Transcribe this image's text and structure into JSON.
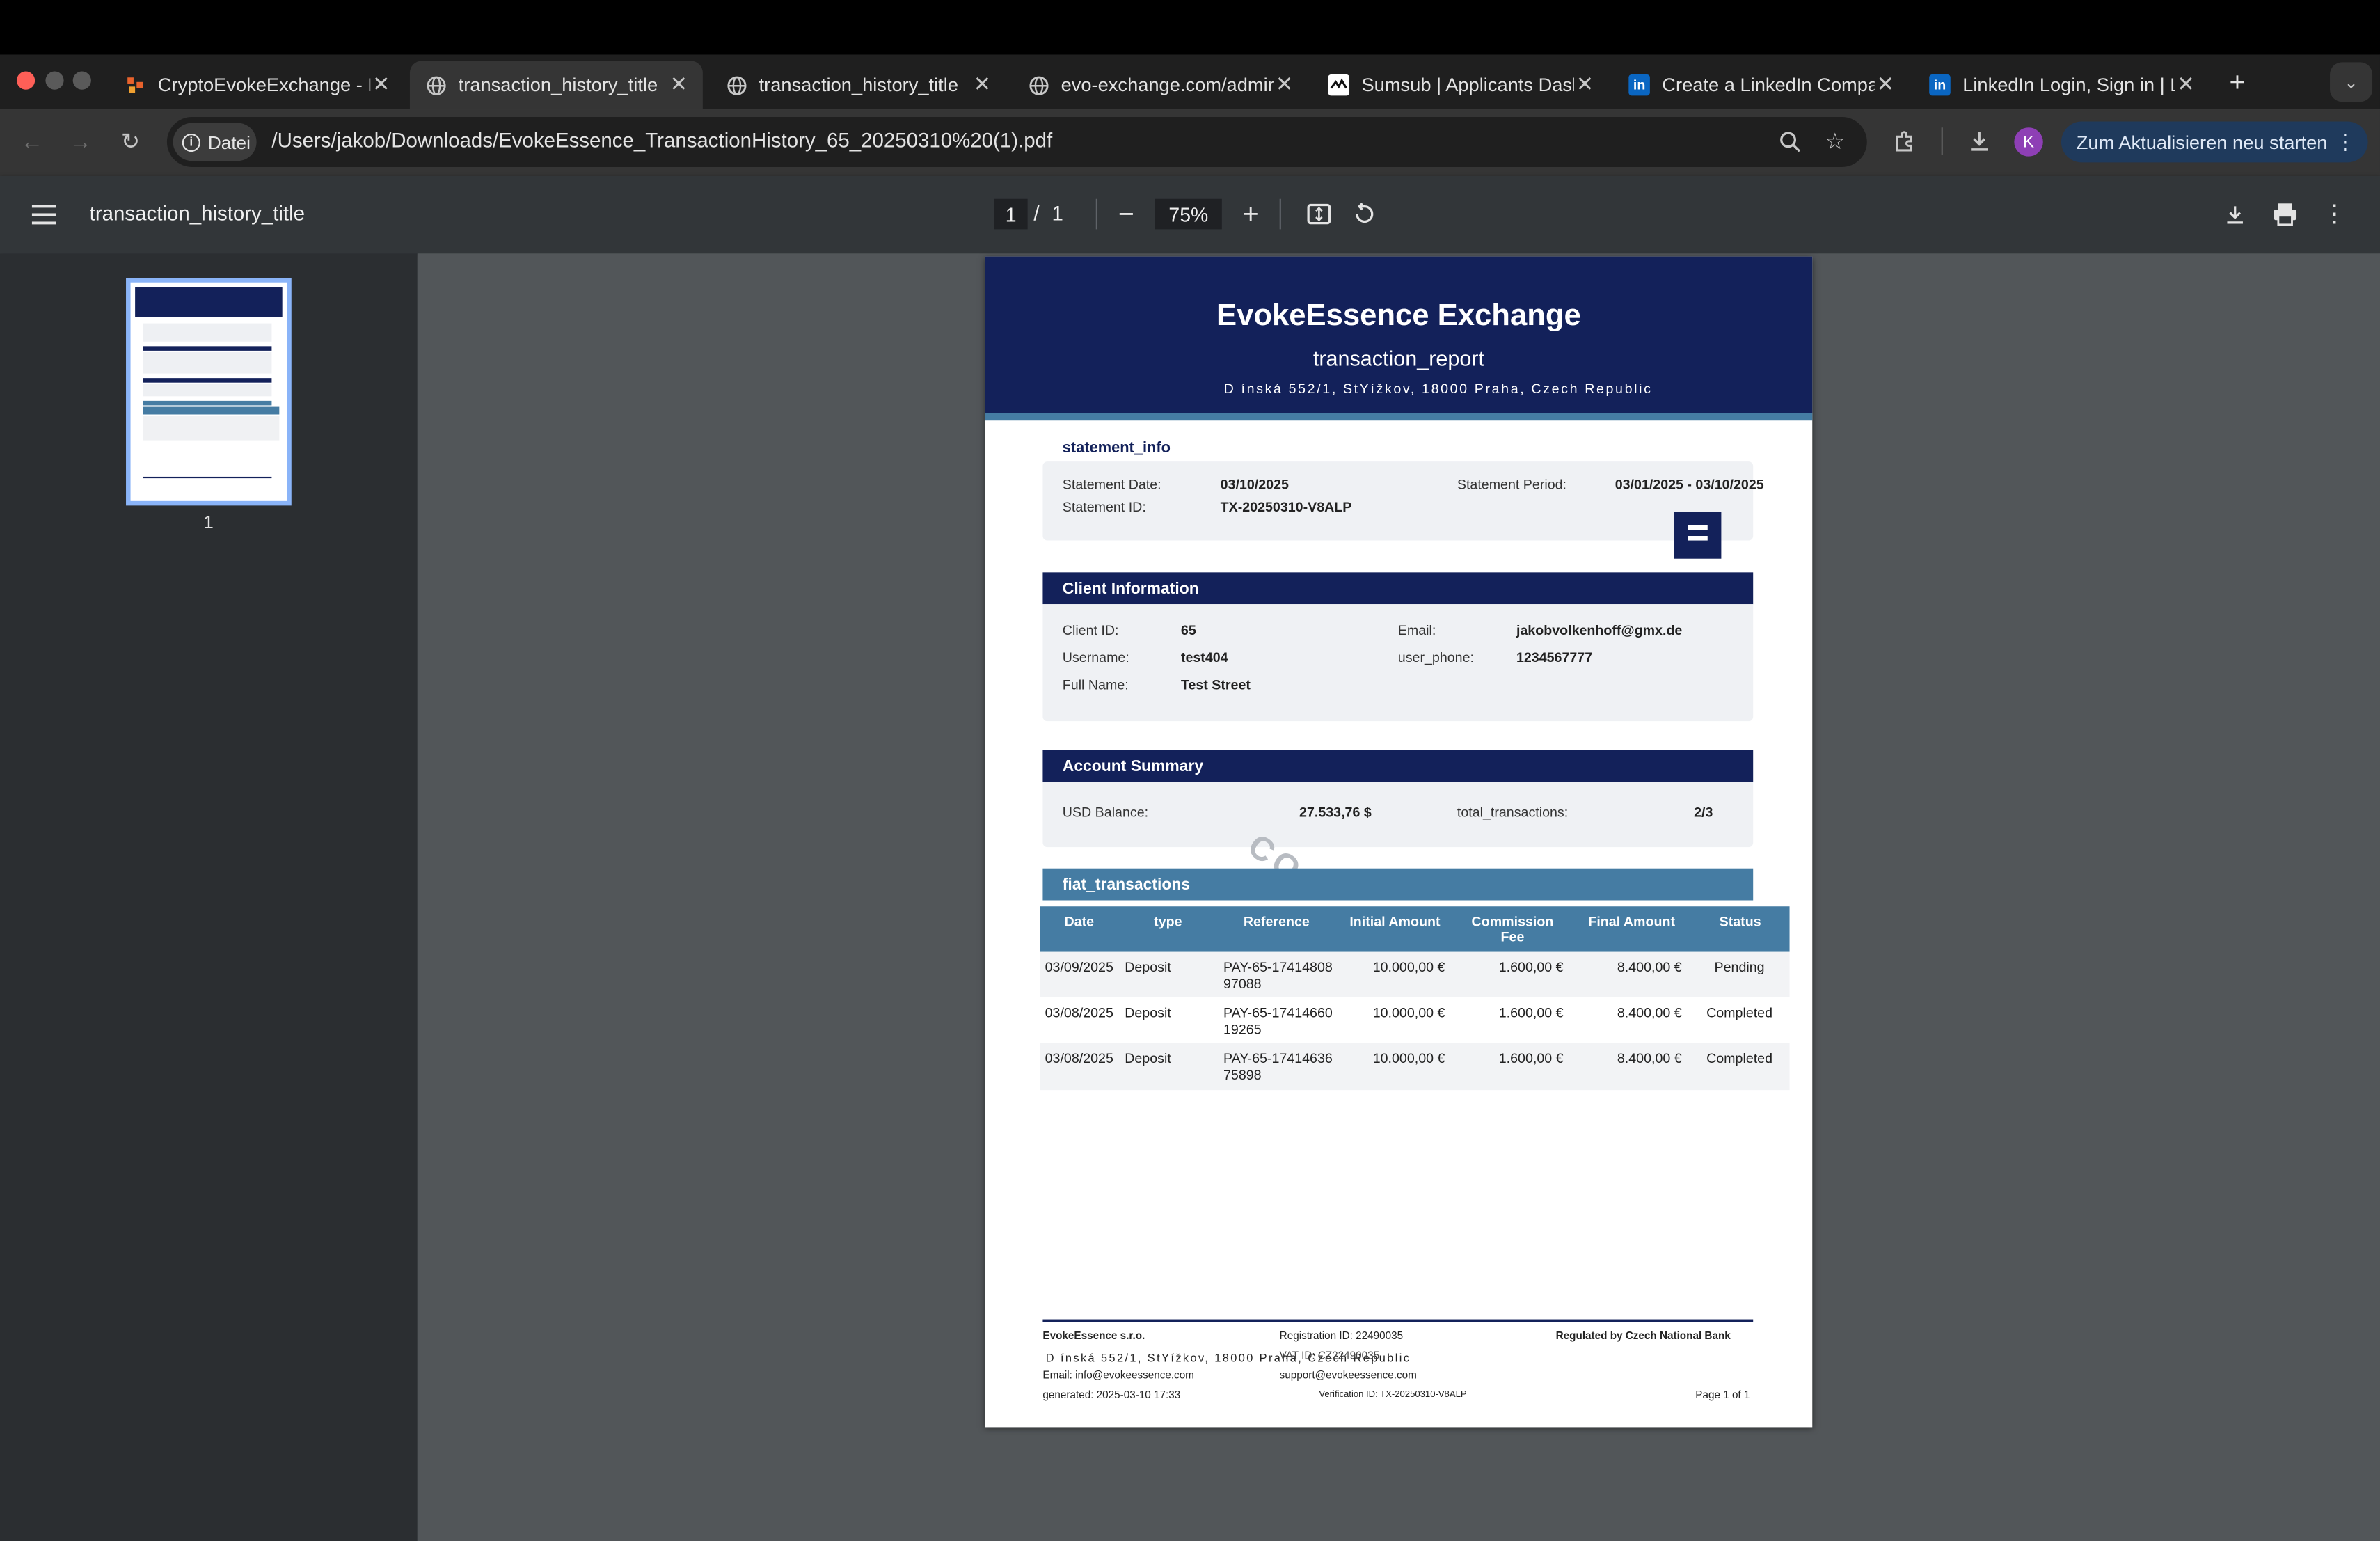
{
  "browser": {
    "tabs": [
      {
        "title": "CryptoEvokeExchange - R",
        "icon": "evoke-favicon"
      },
      {
        "title": "transaction_history_title",
        "icon": "globe-icon"
      },
      {
        "title": "transaction_history_title",
        "icon": "globe-icon"
      },
      {
        "title": "evo-exchange.com/admin",
        "icon": "globe-icon"
      },
      {
        "title": "Sumsub | Applicants Dasl",
        "icon": "sumsub-icon"
      },
      {
        "title": "Create a LinkedIn Compar",
        "icon": "linkedin-icon"
      },
      {
        "title": "LinkedIn Login, Sign in | L",
        "icon": "linkedin-icon"
      }
    ],
    "active_tab_index": 1,
    "address": {
      "chip": "Datei",
      "url": "/Users/jakob/Downloads/EvokeEssence_TransactionHistory_65_20250310%20(1).pdf"
    },
    "profile_initial": "K",
    "update_button": "Zum Aktualisieren neu starten"
  },
  "pdf_toolbar": {
    "title": "transaction_history_title",
    "page_current": "1",
    "page_sep": "/",
    "page_total": "1",
    "zoom": "75%"
  },
  "thumbnail": {
    "page_label": "1"
  },
  "document": {
    "header": {
      "company": "EvokeEssence Exchange",
      "subtitle": "transaction_report",
      "address": "D   ínská 552/1, StYížkov, 18000 Praha, Czech Republic"
    },
    "statement_info": {
      "heading": "statement_info",
      "date_label": "Statement Date:",
      "date_value": "03/10/2025",
      "period_label": "Statement Period:",
      "period_value": "03/01/2025 - 03/10/2025",
      "id_label": "Statement ID:",
      "id_value": "TX-20250310-V8ALP"
    },
    "client": {
      "heading": "Client Information",
      "client_id_label": "Client ID:",
      "client_id_value": "65",
      "email_label": "Email:",
      "email_value": "jakobvolkenhoff@gmx.de",
      "username_label": "Username:",
      "username_value": "test404",
      "phone_label": "user_phone:",
      "phone_value": "1234567777",
      "fullname_label": "Full Name:",
      "fullname_value": "Test Street"
    },
    "summary": {
      "heading": "Account Summary",
      "balance_label": "USD Balance:",
      "balance_value": "27.533,76 $",
      "total_label": "total_transactions:",
      "total_value": "2/3"
    },
    "watermark": "CO",
    "transactions": {
      "heading": "fiat_transactions",
      "columns": [
        "Date",
        "type",
        "Reference",
        "Initial Amount",
        "Commission Fee",
        "Final Amount",
        "Status"
      ],
      "rows": [
        {
          "date": "03/09/2025",
          "type": "Deposit",
          "reference": "PAY-65-1741480897088",
          "initial": "10.000,00 €",
          "fee": "1.600,00 €",
          "final": "8.400,00 €",
          "status": "Pending"
        },
        {
          "date": "03/08/2025",
          "type": "Deposit",
          "reference": "PAY-65-1741466019265",
          "initial": "10.000,00 €",
          "fee": "1.600,00 €",
          "final": "8.400,00 €",
          "status": "Completed"
        },
        {
          "date": "03/08/2025",
          "type": "Deposit",
          "reference": "PAY-65-1741463675898",
          "initial": "10.000,00 €",
          "fee": "1.600,00 €",
          "final": "8.400,00 €",
          "status": "Completed"
        }
      ]
    },
    "footer": {
      "company": "EvokeEssence s.r.o.",
      "address": "D   ínská 552/1, StYížkov, 18000 Praha, Czech Republic",
      "email": "Email: info@evokeessence.com",
      "generated": "generated: 2025-03-10 17:33",
      "registration": "Registration ID: 22490035",
      "vat": "VAT ID: CZ22490035",
      "support": "support@evokeessence.com",
      "verification": "Verification ID: TX-20250310-V8ALP",
      "regulated": "Regulated by Czech National Bank",
      "page": "Page 1 of 1"
    }
  },
  "colors": {
    "header_navy": "#13215a",
    "table_blue": "#457ca3",
    "section_box": "#eff1f4",
    "viewer_bg": "#525659",
    "update_button_bg": "#1f3a5c"
  }
}
